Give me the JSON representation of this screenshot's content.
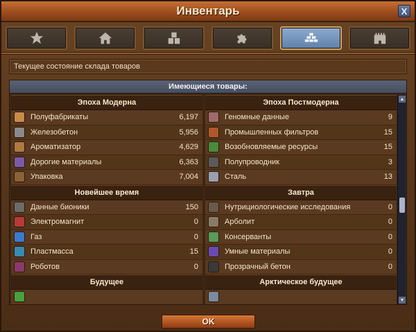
{
  "window": {
    "title": "Инвентарь",
    "close_label": "X"
  },
  "tabs": [
    {
      "icon": "star-icon",
      "active": false
    },
    {
      "icon": "house-icon",
      "active": false
    },
    {
      "icon": "boxes-icon",
      "active": false
    },
    {
      "icon": "puzzle-icon",
      "active": false
    },
    {
      "icon": "bricks-icon",
      "active": true
    },
    {
      "icon": "castle-icon",
      "active": false
    }
  ],
  "subtitle": "Текущее состояние склада товаров",
  "goods": {
    "header": "Имеющиеся товары:",
    "left": [
      {
        "title": "Эпоха Модерна",
        "items": [
          {
            "name": "Полуфабрикаты",
            "value": "6,197",
            "color": "#c98a4a"
          },
          {
            "name": "Железобетон",
            "value": "5,956",
            "color": "#8a8a8a"
          },
          {
            "name": "Ароматизатор",
            "value": "4,629",
            "color": "#b07a40"
          },
          {
            "name": "Дорогие материалы",
            "value": "6,363",
            "color": "#7a5aa8"
          },
          {
            "name": "Упаковка",
            "value": "7,004",
            "color": "#8a6238"
          }
        ]
      },
      {
        "title": "Новейшее время",
        "items": [
          {
            "name": "Данные бионики",
            "value": "150",
            "color": "#6b6b6b"
          },
          {
            "name": "Электромагнит",
            "value": "0",
            "color": "#b83a3a"
          },
          {
            "name": "Газ",
            "value": "0",
            "color": "#3a7ad0"
          },
          {
            "name": "Пластмасса",
            "value": "15",
            "color": "#3a8ab0"
          },
          {
            "name": "Роботов",
            "value": "0",
            "color": "#8a3a6a"
          }
        ]
      },
      {
        "title": "Будущее",
        "items": [
          {
            "name": "",
            "value": "",
            "color": "#4aa040"
          }
        ]
      }
    ],
    "right": [
      {
        "title": "Эпоха Постмодерна",
        "items": [
          {
            "name": "Геномные данные",
            "value": "9",
            "color": "#a06a6a"
          },
          {
            "name": "Промышленных фильтров",
            "value": "15",
            "color": "#b0582a"
          },
          {
            "name": "Возобновляемые ресурсы",
            "value": "15",
            "color": "#4a8a3a"
          },
          {
            "name": "Полупроводник",
            "value": "3",
            "color": "#5a5a5a"
          },
          {
            "name": "Сталь",
            "value": "13",
            "color": "#9aa0b0"
          }
        ]
      },
      {
        "title": "Завтра",
        "items": [
          {
            "name": "Нутрициологические исследования",
            "value": "0",
            "color": "#6a5a4a"
          },
          {
            "name": "Арболит",
            "value": "0",
            "color": "#8a7a6a"
          },
          {
            "name": "Консерванты",
            "value": "0",
            "color": "#5a9a5a"
          },
          {
            "name": "Умные материалы",
            "value": "0",
            "color": "#6a4ab0"
          },
          {
            "name": "Прозрачный бетон",
            "value": "0",
            "color": "#3a3a3a"
          }
        ]
      },
      {
        "title": "Арктическое будущее",
        "items": [
          {
            "name": "",
            "value": "",
            "color": "#7a8aa0"
          }
        ]
      }
    ]
  },
  "ok_label": "OK"
}
